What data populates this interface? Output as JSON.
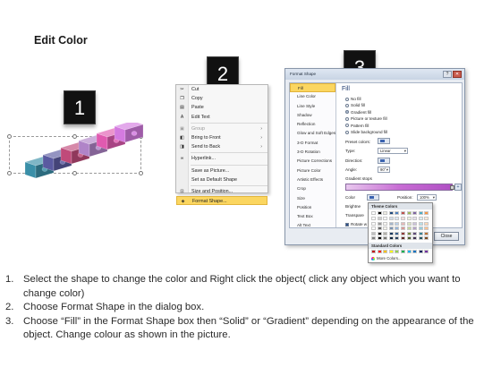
{
  "title": "Edit Color",
  "step_badges": [
    "1",
    "2",
    "3"
  ],
  "context_menu": {
    "items": [
      {
        "label": "Cut",
        "icon": "scissors-icon",
        "state": "normal"
      },
      {
        "label": "Copy",
        "icon": "copy-icon",
        "state": "normal"
      },
      {
        "label": "Paste",
        "icon": "paste-icon",
        "state": "normal"
      },
      {
        "label": "Edit Text",
        "icon": "edit-text-icon",
        "state": "normal"
      },
      {
        "label": "Group",
        "icon": "group-icon",
        "state": "disabled",
        "submenu": true
      },
      {
        "label": "Bring to Front",
        "icon": "bring-front-icon",
        "state": "normal",
        "submenu": true
      },
      {
        "label": "Send to Back",
        "icon": "send-back-icon",
        "state": "normal",
        "submenu": true
      },
      {
        "label": "Hyperlink...",
        "icon": "hyperlink-icon",
        "state": "normal"
      },
      {
        "label": "Save as Picture...",
        "icon": "",
        "state": "normal"
      },
      {
        "label": "Set as Default Shape",
        "icon": "",
        "state": "normal"
      },
      {
        "label": "Size and Position...",
        "icon": "size-position-icon",
        "state": "normal"
      },
      {
        "label": "Format Shape...",
        "icon": "format-shape-icon",
        "state": "highlighted"
      }
    ]
  },
  "format_dialog": {
    "title": "Format Shape",
    "categories": [
      "Fill",
      "Line Color",
      "Line Style",
      "Shadow",
      "Reflection",
      "Glow and Soft Edges",
      "3-D Format",
      "3-D Rotation",
      "Picture Corrections",
      "Picture Color",
      "Artistic Effects",
      "Crop",
      "Size",
      "Position",
      "Text Box",
      "Alt Text"
    ],
    "selected_category": "Fill",
    "panel_heading": "Fill",
    "fill_options": [
      {
        "label": "No fill",
        "checked": false
      },
      {
        "label": "Solid fill",
        "checked": false
      },
      {
        "label": "Gradient fill",
        "checked": true
      },
      {
        "label": "Picture or texture fill",
        "checked": false
      },
      {
        "label": "Pattern fill",
        "checked": false
      },
      {
        "label": "Slide background fill",
        "checked": false
      }
    ],
    "preset_colors_label": "Preset colors:",
    "type_label": "Type:",
    "type_value": "Linear",
    "direction_label": "Direction:",
    "angle_label": "Angle:",
    "angle_value": "90°",
    "gradient_stops_label": "Gradient stops",
    "color_label": "Color",
    "position_label": "Position:",
    "position_value": "100%",
    "brightness_label": "Brightne",
    "transparency_label": "Transpare",
    "rotate_label": "Rotate w",
    "close_label": "Close"
  },
  "palette": {
    "theme_heading": "Theme Colors",
    "standard_heading": "Standard Colors",
    "more_label": "More Colors...",
    "theme_columns": [
      "#ffffff",
      "#000000",
      "#eeece1",
      "#1f497d",
      "#4f81bd",
      "#c0504d",
      "#9bbb59",
      "#8064a2",
      "#4bacc6",
      "#f79646"
    ],
    "standard_colors": [
      "#c00000",
      "#ff0000",
      "#ffc000",
      "#ffff00",
      "#92d050",
      "#00b050",
      "#00b0f0",
      "#0070c0",
      "#002060",
      "#7030a0"
    ]
  },
  "puzzle_colors": [
    "#3a8fa8",
    "#5a5aa0",
    "#c04a7a",
    "#b084c8",
    "#e05ab0",
    "#d47ae0"
  ],
  "instructions": [
    {
      "num": "1.",
      "text": "Select the shape to change the color and Right click the object( click any object which you want to change color)"
    },
    {
      "num": "2.",
      "text": "Choose Format Shape in the dialog box."
    },
    {
      "num": "3.",
      "text": "Choose “Fill” in the Format Shape box then “Solid” or “Gradient” depending on the appearance of the object. Change colour as shown in the picture."
    }
  ]
}
